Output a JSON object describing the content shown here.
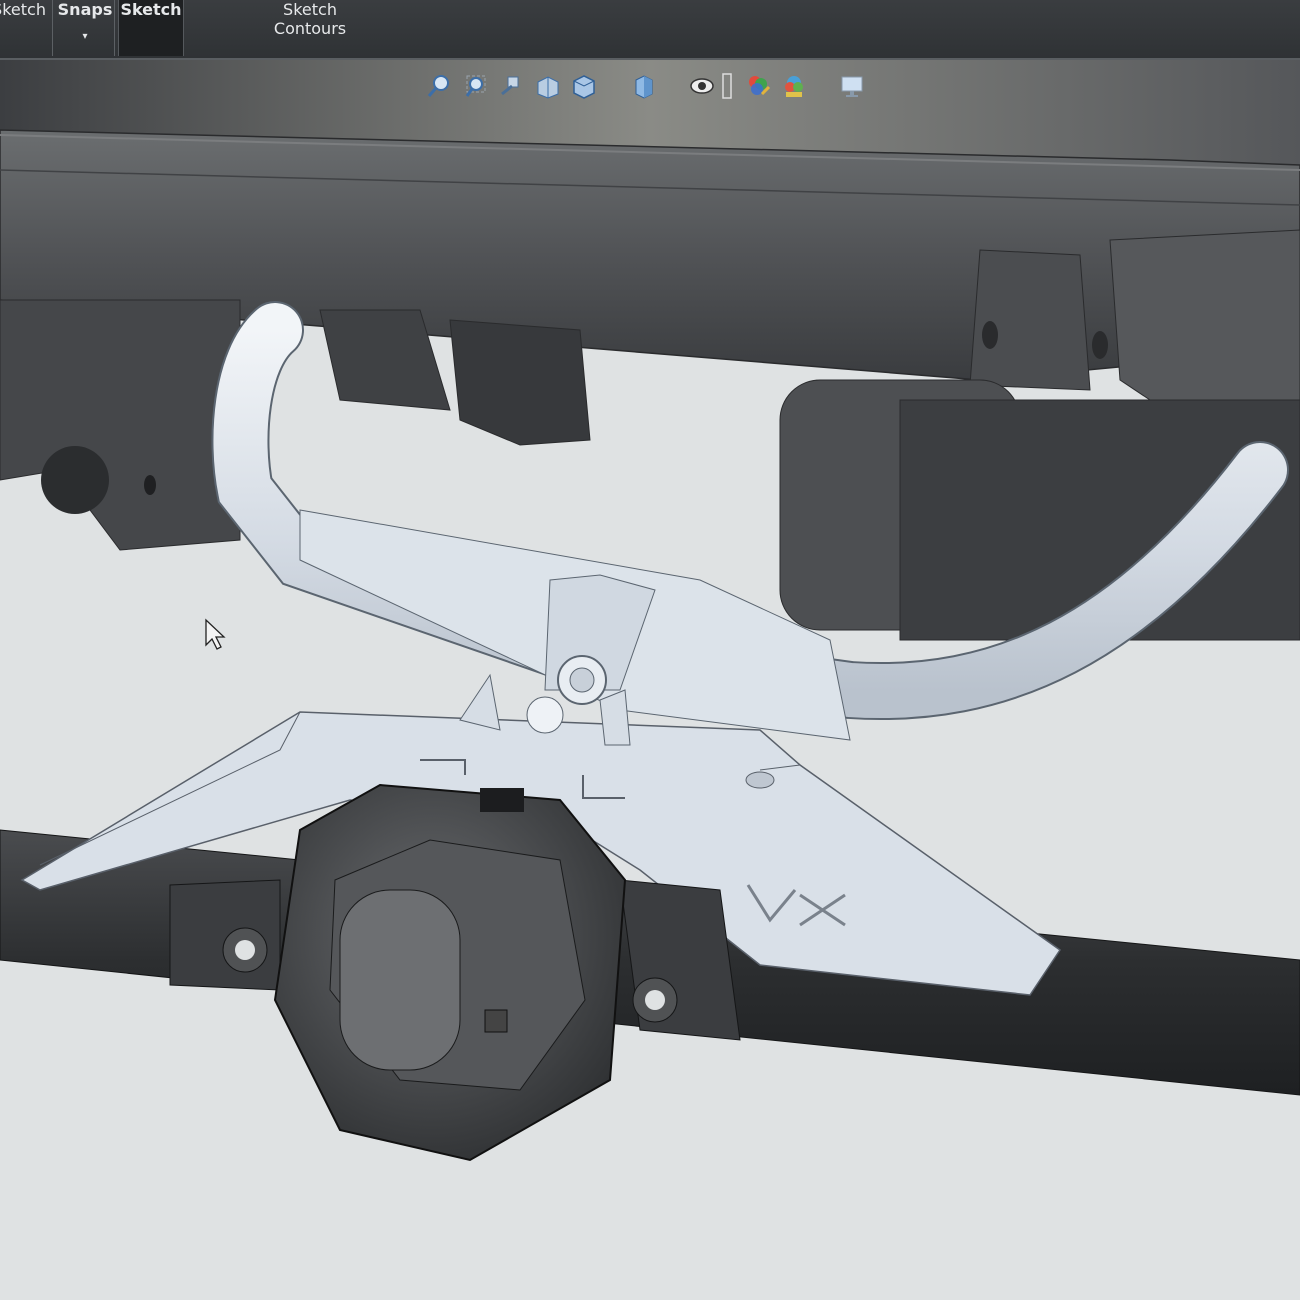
{
  "ribbon": {
    "items": [
      {
        "label": "Sketch"
      },
      {
        "label": "Snaps",
        "caret": "▾"
      },
      {
        "label": "Sketch"
      },
      {
        "label": "Sketch",
        "label2": "Contours"
      }
    ]
  },
  "view_toolbar": {
    "icons": [
      "zoom-to-fit-icon",
      "zoom-to-area-icon",
      "previous-view-icon",
      "section-view-icon",
      "view-orientation-icon",
      "display-style-icon",
      "hide-show-icon",
      "edit-appearance-icon",
      "apply-scene-icon",
      "view-settings-icon"
    ]
  },
  "colors": {
    "ribbon": "#33363a",
    "viewport_bg": "#dfe2e3",
    "frame_dark": "#4a4c4f",
    "part_light": "#d6dde6",
    "axle": "#2a2c2e"
  }
}
